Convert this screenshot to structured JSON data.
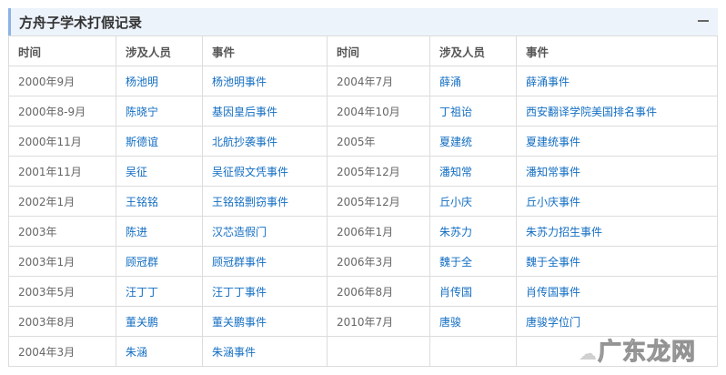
{
  "panel": {
    "title": "方舟子学术打假记录",
    "collapse_icon": "minus-icon"
  },
  "headers": [
    "时间",
    "涉及人员",
    "事件",
    "时间",
    "涉及人员",
    "事件"
  ],
  "rows": [
    [
      [
        "2000年9月",
        "杨池明",
        "杨池明事件"
      ],
      [
        "2004年7月",
        "薛涌",
        "薛涌事件"
      ]
    ],
    [
      [
        "2000年8-9月",
        "陈晓宁",
        "基因皇后事件"
      ],
      [
        "2004年10月",
        "丁祖诒",
        "西安翻译学院美国排名事件"
      ]
    ],
    [
      [
        "2000年11月",
        "斯德谊",
        "北航抄袭事件"
      ],
      [
        "2005年",
        "夏建统",
        "夏建统事件"
      ]
    ],
    [
      [
        "2001年11月",
        "吴征",
        "吴征假文凭事件"
      ],
      [
        "2005年12月",
        "潘知常",
        "潘知常事件"
      ]
    ],
    [
      [
        "2002年1月",
        "王铭铭",
        "王铭铭剽窃事件"
      ],
      [
        "2005年12月",
        "丘小庆",
        "丘小庆事件"
      ]
    ],
    [
      [
        "2003年",
        "陈进",
        "汉芯造假门"
      ],
      [
        "2006年1月",
        "朱苏力",
        "朱苏力招生事件"
      ]
    ],
    [
      [
        "2003年1月",
        "顾冠群",
        "顾冠群事件"
      ],
      [
        "2006年3月",
        "魏于全",
        "魏于全事件"
      ]
    ],
    [
      [
        "2003年5月",
        "汪丁丁",
        "汪丁丁事件"
      ],
      [
        "2006年8月",
        "肖传国",
        "肖传国事件"
      ]
    ],
    [
      [
        "2003年8月",
        "董关鹏",
        "董关鹏事件"
      ],
      [
        "2010年7月",
        "唐骏",
        "唐骏学位门"
      ]
    ],
    [
      [
        "2004年3月",
        "朱涵",
        "朱涵事件"
      ],
      [
        "",
        "",
        ""
      ]
    ]
  ],
  "watermark": "广东龙网"
}
